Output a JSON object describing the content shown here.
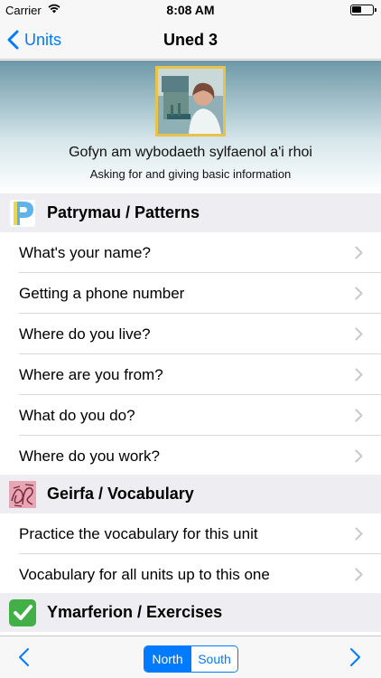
{
  "status_bar": {
    "carrier": "Carrier",
    "time": "8:08 AM"
  },
  "nav": {
    "back_label": "Units",
    "title": "Uned 3"
  },
  "banner": {
    "subtitle_welsh": "Gofyn am wybodaeth sylfaenol a'i rhoi",
    "subtitle_english": "Asking for and giving basic information"
  },
  "sections": [
    {
      "title": "Patrymau / Patterns",
      "icon": "p-letter-icon",
      "items": [
        {
          "label": "What's your name?"
        },
        {
          "label": "Getting a phone number"
        },
        {
          "label": "Where do you live?"
        },
        {
          "label": "Where are you from?"
        },
        {
          "label": "What do you do?"
        },
        {
          "label": "Where do you work?"
        }
      ]
    },
    {
      "title": "Geirfa / Vocabulary",
      "icon": "vocabulary-icon",
      "items": [
        {
          "label": "Practice the vocabulary for this unit"
        },
        {
          "label": "Vocabulary for all units up to this one"
        }
      ]
    },
    {
      "title": "Ymarferion / Exercises",
      "icon": "checkmark-icon",
      "items": []
    }
  ],
  "toolbar": {
    "segments": [
      "North",
      "South"
    ],
    "selected": "North"
  },
  "colors": {
    "accent": "#007aff",
    "section_bg": "#eeeef2",
    "check_green": "#43b047"
  }
}
